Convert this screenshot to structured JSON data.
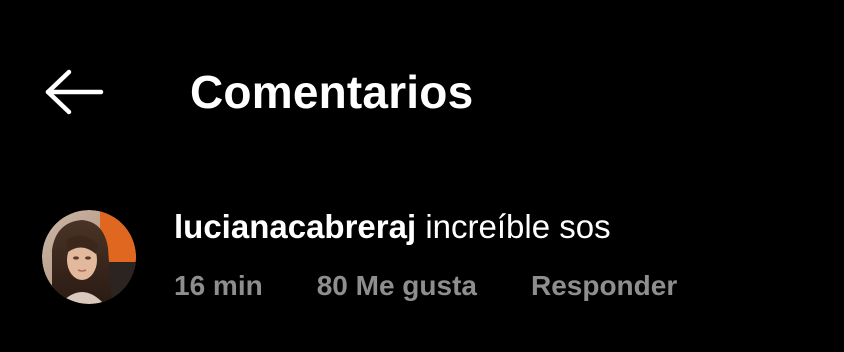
{
  "colors": {
    "background": "#000000",
    "text_primary": "#ffffff",
    "text_secondary": "#8e8e8e"
  },
  "header": {
    "back_icon": "arrow-left-icon",
    "title": "Comentarios"
  },
  "comment": {
    "avatar_icon": "user-avatar-photo",
    "username": "lucianacabreraj",
    "text": "increíble sos",
    "time": "16 min",
    "likes": "80 Me gusta",
    "reply_label": "Responder"
  }
}
